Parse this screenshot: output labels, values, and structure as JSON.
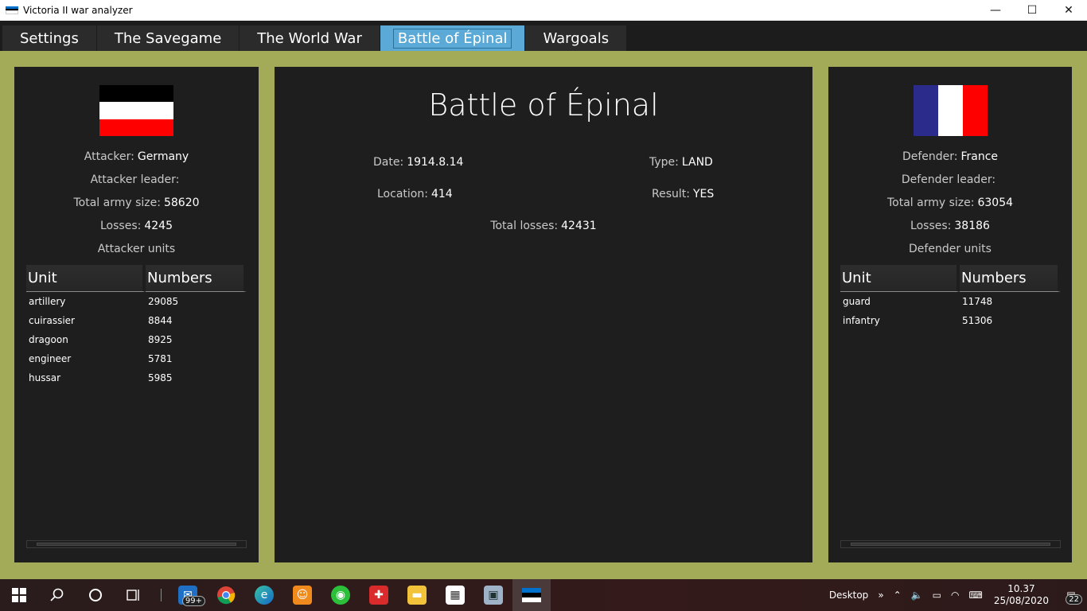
{
  "window": {
    "title": "Victoria II war analyzer",
    "controls": {
      "minimize": "—",
      "maximize": "☐",
      "close": "✕"
    }
  },
  "tabs": [
    {
      "label": "Settings",
      "active": false
    },
    {
      "label": "The Savegame",
      "active": false
    },
    {
      "label": "The World War",
      "active": false
    },
    {
      "label": "Battle of Épinal",
      "active": true
    },
    {
      "label": "Wargoals",
      "active": false
    }
  ],
  "colors": {
    "background": "#a4ab58",
    "panel": "#1e1e1e",
    "active_tab": "#5aa9d6",
    "germany_flag": [
      "#000000",
      "#ffffff",
      "#ff0000"
    ],
    "france_flag": [
      "#2b2b8c",
      "#ffffff",
      "#ff0000"
    ]
  },
  "attacker": {
    "flag_icon": "germany-flag-icon",
    "side_label": "Attacker:",
    "country": "Germany",
    "leader_label": "Attacker leader:",
    "leader": "",
    "army_label": "Total army size:",
    "army_size": "58620",
    "losses_label": "Losses:",
    "losses": "4245",
    "units_heading": "Attacker units",
    "columns": [
      "Unit",
      "Numbers"
    ],
    "units": [
      {
        "unit": "artillery",
        "numbers": "29085"
      },
      {
        "unit": "cuirassier",
        "numbers": "8844"
      },
      {
        "unit": "dragoon",
        "numbers": "8925"
      },
      {
        "unit": "engineer",
        "numbers": "5781"
      },
      {
        "unit": "hussar",
        "numbers": "5985"
      }
    ]
  },
  "battle": {
    "title": "Battle of Épinal",
    "date_label": "Date:",
    "date": "1914.8.14",
    "type_label": "Type:",
    "type": "LAND",
    "location_label": "Location:",
    "location": "414",
    "result_label": "Result:",
    "result": "YES",
    "total_losses_label": "Total losses:",
    "total_losses": "42431"
  },
  "defender": {
    "flag_icon": "france-flag-icon",
    "side_label": "Defender:",
    "country": "France",
    "leader_label": "Defender leader:",
    "leader": "",
    "army_label": "Total army size:",
    "army_size": "63054",
    "losses_label": "Losses:",
    "losses": "38186",
    "units_heading": "Defender units",
    "columns": [
      "Unit",
      "Numbers"
    ],
    "units": [
      {
        "unit": "guard",
        "numbers": "11748"
      },
      {
        "unit": "infantry",
        "numbers": "51306"
      }
    ]
  },
  "taskbar": {
    "mail_badge": "99+",
    "notification_badge": "22",
    "desktop_label": "Desktop",
    "time": "10.37",
    "date": "25/08/2020"
  }
}
